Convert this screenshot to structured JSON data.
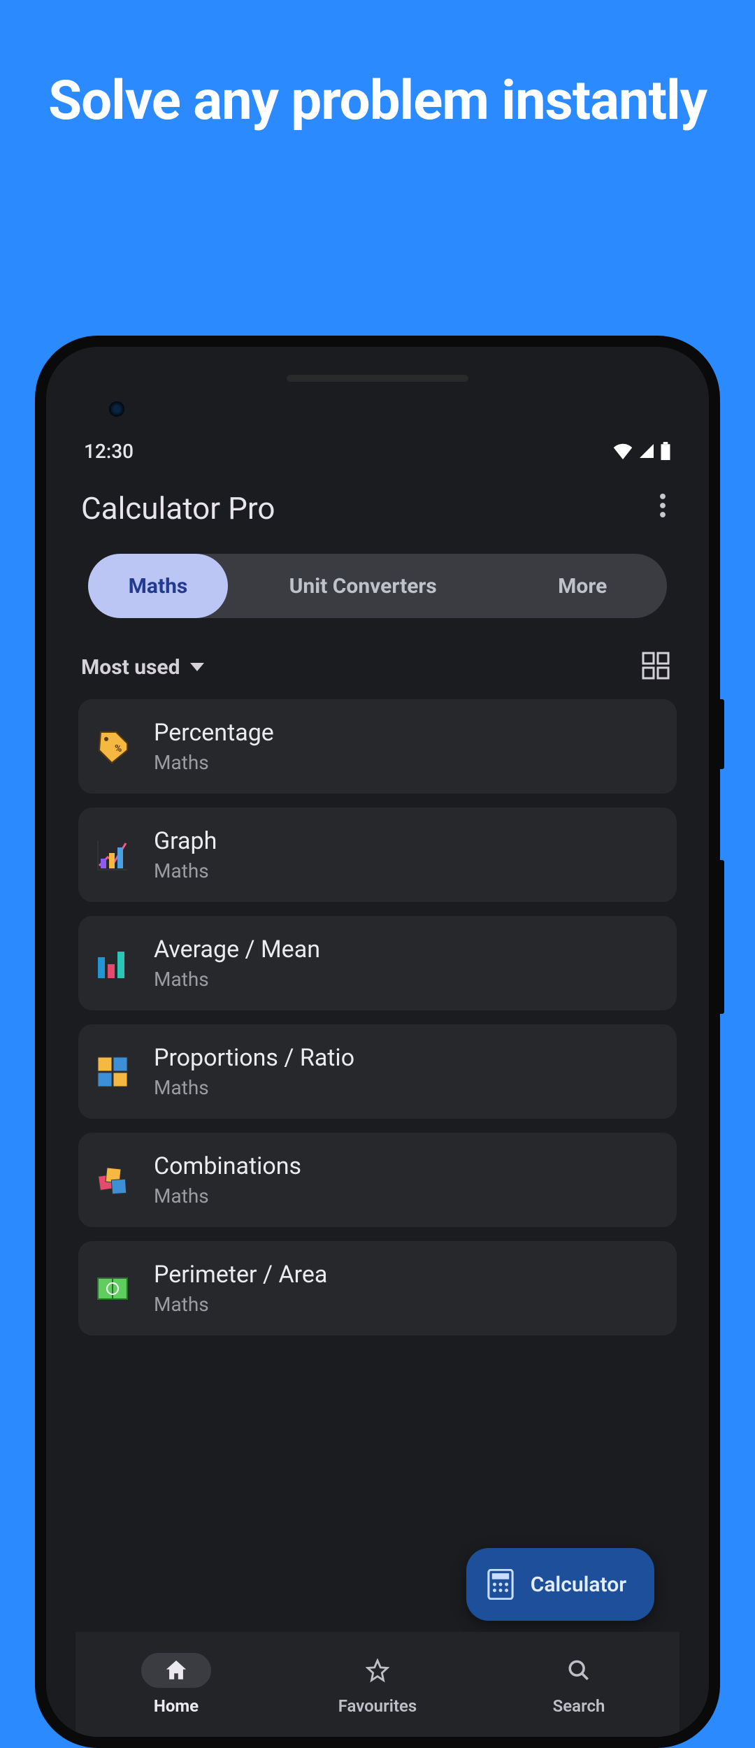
{
  "hero": {
    "title": "Solve any problem instantly"
  },
  "statusbar": {
    "time": "12:30"
  },
  "header": {
    "title": "Calculator Pro"
  },
  "tabs": {
    "items": [
      {
        "label": "Maths",
        "active": true
      },
      {
        "label": "Unit Converters",
        "active": false
      },
      {
        "label": "More",
        "active": false
      }
    ]
  },
  "filter": {
    "sort_label": "Most used"
  },
  "list": {
    "items": [
      {
        "title": "Percentage",
        "subtitle": "Maths",
        "icon": "tag"
      },
      {
        "title": "Graph",
        "subtitle": "Maths",
        "icon": "linechart"
      },
      {
        "title": "Average / Mean",
        "subtitle": "Maths",
        "icon": "barchart"
      },
      {
        "title": "Proportions / Ratio",
        "subtitle": "Maths",
        "icon": "grid4"
      },
      {
        "title": "Combinations",
        "subtitle": "Maths",
        "icon": "cubes"
      },
      {
        "title": "Perimeter / Area",
        "subtitle": "Maths",
        "icon": "field"
      }
    ]
  },
  "fab": {
    "label": "Calculator"
  },
  "bottombar": {
    "items": [
      {
        "label": "Home",
        "icon": "home",
        "active": true
      },
      {
        "label": "Favourites",
        "icon": "star",
        "active": false
      },
      {
        "label": "Search",
        "icon": "search",
        "active": false
      }
    ]
  }
}
